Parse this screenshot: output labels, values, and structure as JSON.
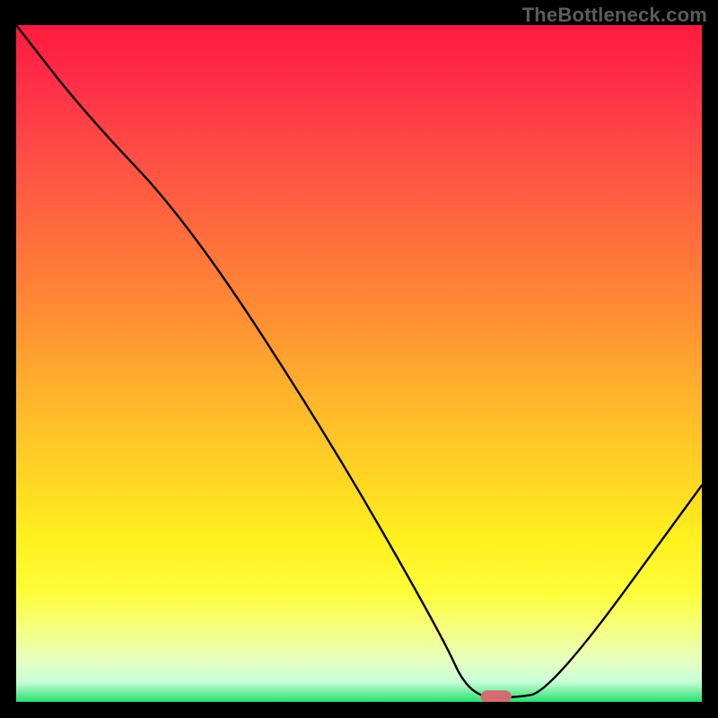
{
  "watermark": "TheBottleneck.com",
  "chart_data": {
    "type": "line",
    "title": "",
    "xlabel": "",
    "ylabel": "",
    "xlim": [
      0,
      100
    ],
    "ylim": [
      0,
      100
    ],
    "series": [
      {
        "name": "curve",
        "x": [
          0,
          10,
          25,
          45,
          62,
          66,
          72,
          78,
          100
        ],
        "values": [
          100,
          87,
          71,
          40,
          10,
          1,
          0.5,
          1.5,
          32
        ]
      }
    ],
    "marker": {
      "x": 70,
      "y": 0.5,
      "color": "#d46a72"
    },
    "gradient_stops": [
      {
        "pos": 0,
        "color": "#ff1a3f"
      },
      {
        "pos": 18,
        "color": "#ff4a46"
      },
      {
        "pos": 42,
        "color": "#ff8b34"
      },
      {
        "pos": 66,
        "color": "#ffd324"
      },
      {
        "pos": 84,
        "color": "#fdfd3a"
      },
      {
        "pos": 97,
        "color": "#c8ffd8"
      },
      {
        "pos": 100,
        "color": "#28e070"
      }
    ]
  }
}
